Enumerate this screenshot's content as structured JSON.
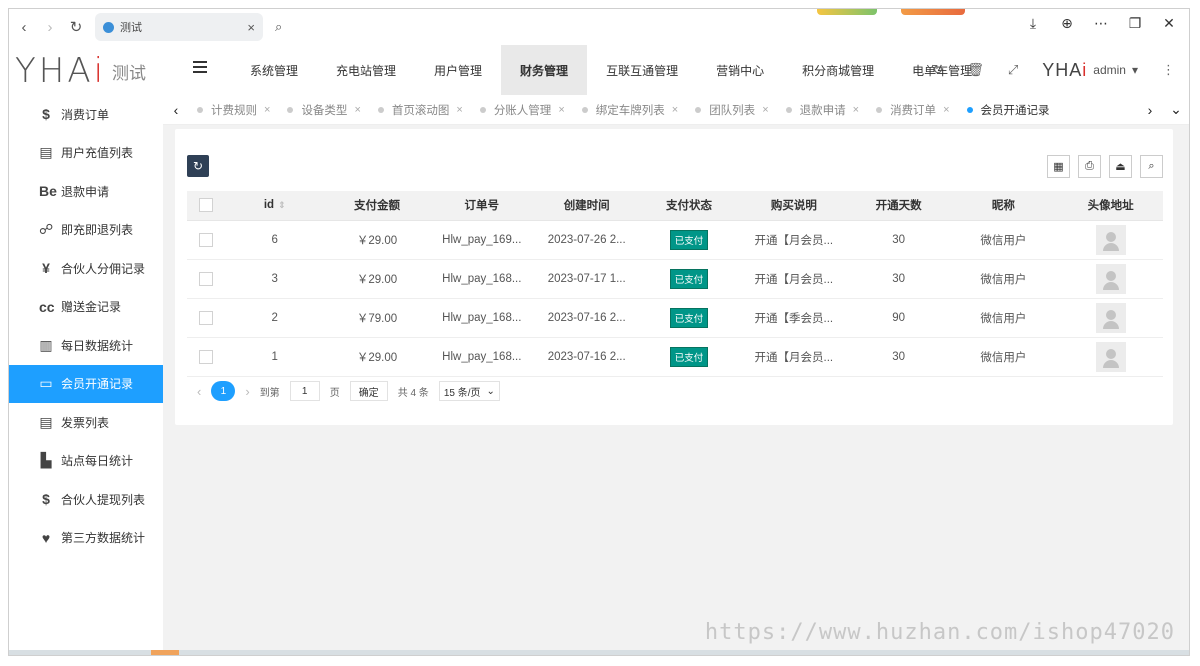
{
  "browser": {
    "tab_title": "测试",
    "tab_close": "×",
    "back": "‹",
    "forward": "›",
    "reload": "↻",
    "search": "⌕",
    "right_icons": [
      "download-icon",
      "globe-icon",
      "more-icon",
      "restore-icon",
      "close-icon"
    ]
  },
  "header": {
    "logo_text": "YHA",
    "logo_ai": "i",
    "logo_sub": "测试",
    "nav": [
      "系统管理",
      "充电站管理",
      "用户管理",
      "财务管理",
      "互联互通管理",
      "营销中心",
      "积分商城管理",
      "电单车管理"
    ],
    "nav_active_index": 3,
    "user": "admin",
    "user_logo": "YHA",
    "user_logo_ai": "i"
  },
  "sidebar": {
    "items": [
      {
        "icon": "$",
        "label": "消费订单"
      },
      {
        "icon": "▤",
        "label": "用户充值列表"
      },
      {
        "icon": "Be",
        "label": "退款申请"
      },
      {
        "icon": "☍",
        "label": "即充即退列表"
      },
      {
        "icon": "¥",
        "label": "合伙人分佣记录"
      },
      {
        "icon": "cc",
        "label": "赠送金记录"
      },
      {
        "icon": "▥",
        "label": "每日数据统计"
      },
      {
        "icon": "▭",
        "label": "会员开通记录"
      },
      {
        "icon": "▤",
        "label": "发票列表"
      },
      {
        "icon": "▙",
        "label": "站点每日统计"
      },
      {
        "icon": "$",
        "label": "合伙人提现列表"
      },
      {
        "icon": "♥",
        "label": "第三方数据统计"
      }
    ],
    "active_index": 7
  },
  "tabs": {
    "items": [
      "计费规则",
      "设备类型",
      "首页滚动图",
      "分账人管理",
      "绑定车牌列表",
      "团队列表",
      "退款申请",
      "消费订单",
      "会员开通记录"
    ],
    "active_index": 8,
    "close": "×",
    "prev": "‹",
    "next": "›",
    "more": "⌄"
  },
  "table": {
    "headers": [
      "id",
      "支付金额",
      "订单号",
      "创建时间",
      "支付状态",
      "购买说明",
      "开通天数",
      "昵称",
      "头像地址"
    ],
    "rows": [
      {
        "id": "6",
        "amount": "￥29.00",
        "order": "Hlw_pay_169...",
        "created": "2023-07-26 2...",
        "status": "已支付",
        "desc": "开通【月会员...",
        "days": "30",
        "nick": "微信用户"
      },
      {
        "id": "3",
        "amount": "￥29.00",
        "order": "Hlw_pay_168...",
        "created": "2023-07-17 1...",
        "status": "已支付",
        "desc": "开通【月会员...",
        "days": "30",
        "nick": "微信用户"
      },
      {
        "id": "2",
        "amount": "￥79.00",
        "order": "Hlw_pay_168...",
        "created": "2023-07-16 2...",
        "status": "已支付",
        "desc": "开通【季会员...",
        "days": "90",
        "nick": "微信用户"
      },
      {
        "id": "1",
        "amount": "￥29.00",
        "order": "Hlw_pay_168...",
        "created": "2023-07-16 2...",
        "status": "已支付",
        "desc": "开通【月会员...",
        "days": "30",
        "nick": "微信用户"
      }
    ]
  },
  "pager": {
    "current": "1",
    "goto": "到第",
    "page_input": "1",
    "page_unit": "页",
    "confirm": "确定",
    "total": "共 4 条",
    "per_page": "15 条/页"
  },
  "watermark": "https://www.huzhan.com/ishop47020",
  "colors": {
    "accent": "#1e9fff",
    "status_paid": "#009688",
    "dark": "#2f4056"
  }
}
